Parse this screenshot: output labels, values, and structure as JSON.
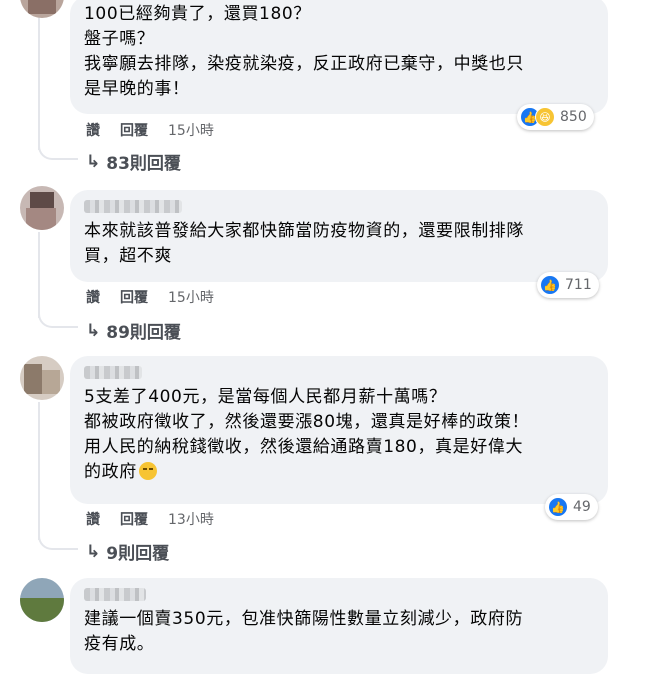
{
  "comments": [
    {
      "text_lines": [
        "100已經夠貴了，還買180？",
        "盤子嗎？",
        "我寧願去排隊，染疫就染疫，反正政府已棄守，中獎也只",
        "是早晚的事！"
      ],
      "reaction_count": "850",
      "reaction_icons": [
        "like-icon",
        "haha-icon"
      ],
      "actions": {
        "like": "讚",
        "reply": "回覆",
        "time": "15小時"
      },
      "replies_label": "83則回覆"
    },
    {
      "text_lines": [
        "本來就該普發給大家都快篩當防疫物資的，還要限制排隊",
        "買，超不爽"
      ],
      "reaction_count": "711",
      "reaction_icons": [
        "like-icon"
      ],
      "actions": {
        "like": "讚",
        "reply": "回覆",
        "time": "15小時"
      },
      "replies_label": "89則回覆"
    },
    {
      "text_lines": [
        "5支差了400元，是當每個人民都月薪十萬嗎？",
        "都被政府徵收了，然後還要漲80塊，還真是好棒的政策！",
        "用人民的納稅錢徵收，然後還給通路賣180，真是好偉大",
        "的政府"
      ],
      "reaction_count": "49",
      "reaction_icons": [
        "like-icon"
      ],
      "actions": {
        "like": "讚",
        "reply": "回覆",
        "time": "13小時"
      },
      "replies_label": "9則回覆"
    },
    {
      "text_lines": [
        "建議一個賣350元，包准快篩陽性數量立刻減少，政府防",
        "疫有成。"
      ]
    }
  ],
  "colors": {
    "bubble_bg": "#f0f2f5",
    "like_blue": "#1877f2",
    "haha_yellow": "#f7c433",
    "meta_gray": "#65676b"
  }
}
